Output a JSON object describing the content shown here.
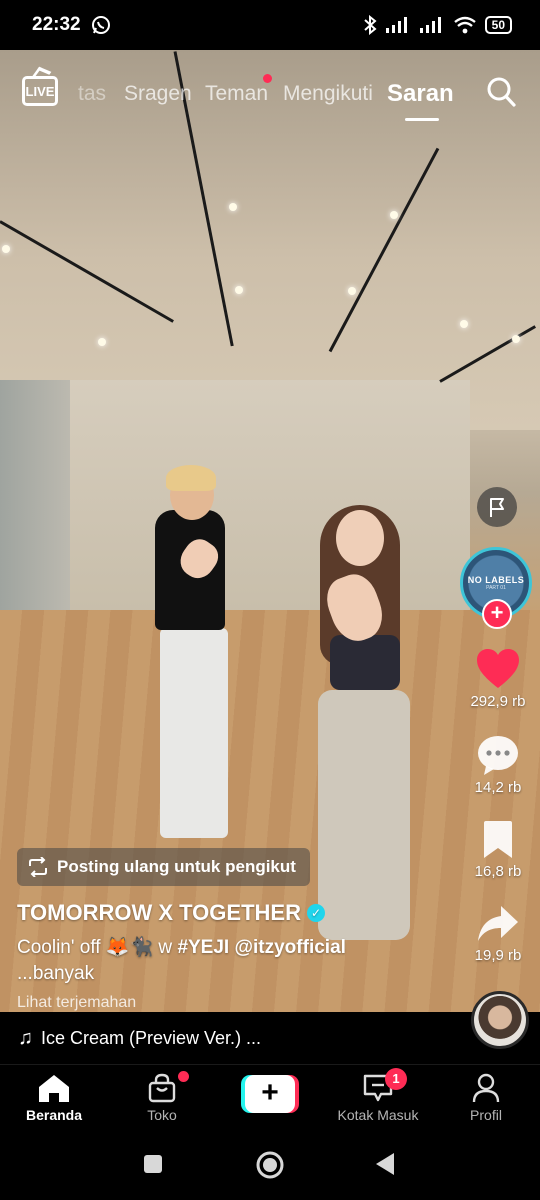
{
  "status_bar": {
    "time": "22:32",
    "battery": "50"
  },
  "top_nav": {
    "live_label": "LIVE",
    "tabs": [
      {
        "label": "tas"
      },
      {
        "label": "Sragen"
      },
      {
        "label": "Teman"
      },
      {
        "label": "Mengikuti"
      },
      {
        "label": "Saran"
      }
    ]
  },
  "rail": {
    "album_line1": "NO LABELS",
    "album_line2": "PART 01",
    "likes": "292,9 rb",
    "comments": "14,2 rb",
    "saves": "16,8 rb",
    "shares": "19,9 rb"
  },
  "post": {
    "repost_label": "Posting ulang untuk pengikut",
    "author": "TOMORROW X TOGETHER",
    "caption_text": "Coolin' off 🦊🐈‍⬛ w",
    "caption_tag": "#YEJI",
    "caption_mention": "@itzyofficial",
    "caption_more": "...banyak",
    "translate_label": "Lihat terjemahan"
  },
  "music": {
    "title": "Ice Cream (Preview Ver.) ..."
  },
  "bottom_nav": {
    "home": "Beranda",
    "shop": "Toko",
    "inbox": "Kotak Masuk",
    "inbox_badge": "1",
    "profile": "Profil"
  },
  "colors": {
    "accent_red": "#fe2c55",
    "accent_cyan": "#25f4ee",
    "verified_blue": "#20d5ec"
  }
}
